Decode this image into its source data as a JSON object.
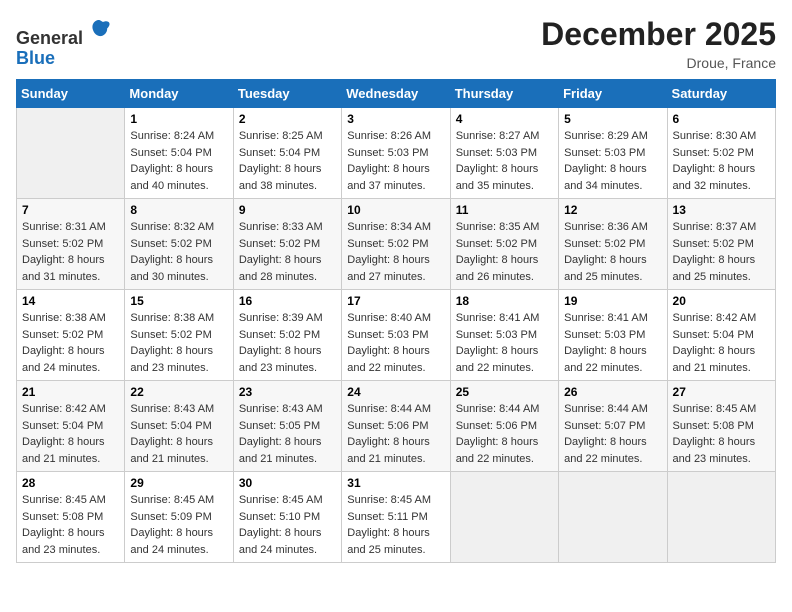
{
  "header": {
    "logo_line1": "General",
    "logo_line2": "Blue",
    "month_title": "December 2025",
    "location": "Droue, France"
  },
  "days_of_week": [
    "Sunday",
    "Monday",
    "Tuesday",
    "Wednesday",
    "Thursday",
    "Friday",
    "Saturday"
  ],
  "weeks": [
    [
      {
        "day": "",
        "info": ""
      },
      {
        "day": "1",
        "info": "Sunrise: 8:24 AM\nSunset: 5:04 PM\nDaylight: 8 hours\nand 40 minutes."
      },
      {
        "day": "2",
        "info": "Sunrise: 8:25 AM\nSunset: 5:04 PM\nDaylight: 8 hours\nand 38 minutes."
      },
      {
        "day": "3",
        "info": "Sunrise: 8:26 AM\nSunset: 5:03 PM\nDaylight: 8 hours\nand 37 minutes."
      },
      {
        "day": "4",
        "info": "Sunrise: 8:27 AM\nSunset: 5:03 PM\nDaylight: 8 hours\nand 35 minutes."
      },
      {
        "day": "5",
        "info": "Sunrise: 8:29 AM\nSunset: 5:03 PM\nDaylight: 8 hours\nand 34 minutes."
      },
      {
        "day": "6",
        "info": "Sunrise: 8:30 AM\nSunset: 5:02 PM\nDaylight: 8 hours\nand 32 minutes."
      }
    ],
    [
      {
        "day": "7",
        "info": "Sunrise: 8:31 AM\nSunset: 5:02 PM\nDaylight: 8 hours\nand 31 minutes."
      },
      {
        "day": "8",
        "info": "Sunrise: 8:32 AM\nSunset: 5:02 PM\nDaylight: 8 hours\nand 30 minutes."
      },
      {
        "day": "9",
        "info": "Sunrise: 8:33 AM\nSunset: 5:02 PM\nDaylight: 8 hours\nand 28 minutes."
      },
      {
        "day": "10",
        "info": "Sunrise: 8:34 AM\nSunset: 5:02 PM\nDaylight: 8 hours\nand 27 minutes."
      },
      {
        "day": "11",
        "info": "Sunrise: 8:35 AM\nSunset: 5:02 PM\nDaylight: 8 hours\nand 26 minutes."
      },
      {
        "day": "12",
        "info": "Sunrise: 8:36 AM\nSunset: 5:02 PM\nDaylight: 8 hours\nand 25 minutes."
      },
      {
        "day": "13",
        "info": "Sunrise: 8:37 AM\nSunset: 5:02 PM\nDaylight: 8 hours\nand 25 minutes."
      }
    ],
    [
      {
        "day": "14",
        "info": "Sunrise: 8:38 AM\nSunset: 5:02 PM\nDaylight: 8 hours\nand 24 minutes."
      },
      {
        "day": "15",
        "info": "Sunrise: 8:38 AM\nSunset: 5:02 PM\nDaylight: 8 hours\nand 23 minutes."
      },
      {
        "day": "16",
        "info": "Sunrise: 8:39 AM\nSunset: 5:02 PM\nDaylight: 8 hours\nand 23 minutes."
      },
      {
        "day": "17",
        "info": "Sunrise: 8:40 AM\nSunset: 5:03 PM\nDaylight: 8 hours\nand 22 minutes."
      },
      {
        "day": "18",
        "info": "Sunrise: 8:41 AM\nSunset: 5:03 PM\nDaylight: 8 hours\nand 22 minutes."
      },
      {
        "day": "19",
        "info": "Sunrise: 8:41 AM\nSunset: 5:03 PM\nDaylight: 8 hours\nand 22 minutes."
      },
      {
        "day": "20",
        "info": "Sunrise: 8:42 AM\nSunset: 5:04 PM\nDaylight: 8 hours\nand 21 minutes."
      }
    ],
    [
      {
        "day": "21",
        "info": "Sunrise: 8:42 AM\nSunset: 5:04 PM\nDaylight: 8 hours\nand 21 minutes."
      },
      {
        "day": "22",
        "info": "Sunrise: 8:43 AM\nSunset: 5:04 PM\nDaylight: 8 hours\nand 21 minutes."
      },
      {
        "day": "23",
        "info": "Sunrise: 8:43 AM\nSunset: 5:05 PM\nDaylight: 8 hours\nand 21 minutes."
      },
      {
        "day": "24",
        "info": "Sunrise: 8:44 AM\nSunset: 5:06 PM\nDaylight: 8 hours\nand 21 minutes."
      },
      {
        "day": "25",
        "info": "Sunrise: 8:44 AM\nSunset: 5:06 PM\nDaylight: 8 hours\nand 22 minutes."
      },
      {
        "day": "26",
        "info": "Sunrise: 8:44 AM\nSunset: 5:07 PM\nDaylight: 8 hours\nand 22 minutes."
      },
      {
        "day": "27",
        "info": "Sunrise: 8:45 AM\nSunset: 5:08 PM\nDaylight: 8 hours\nand 23 minutes."
      }
    ],
    [
      {
        "day": "28",
        "info": "Sunrise: 8:45 AM\nSunset: 5:08 PM\nDaylight: 8 hours\nand 23 minutes."
      },
      {
        "day": "29",
        "info": "Sunrise: 8:45 AM\nSunset: 5:09 PM\nDaylight: 8 hours\nand 24 minutes."
      },
      {
        "day": "30",
        "info": "Sunrise: 8:45 AM\nSunset: 5:10 PM\nDaylight: 8 hours\nand 24 minutes."
      },
      {
        "day": "31",
        "info": "Sunrise: 8:45 AM\nSunset: 5:11 PM\nDaylight: 8 hours\nand 25 minutes."
      },
      {
        "day": "",
        "info": ""
      },
      {
        "day": "",
        "info": ""
      },
      {
        "day": "",
        "info": ""
      }
    ]
  ]
}
